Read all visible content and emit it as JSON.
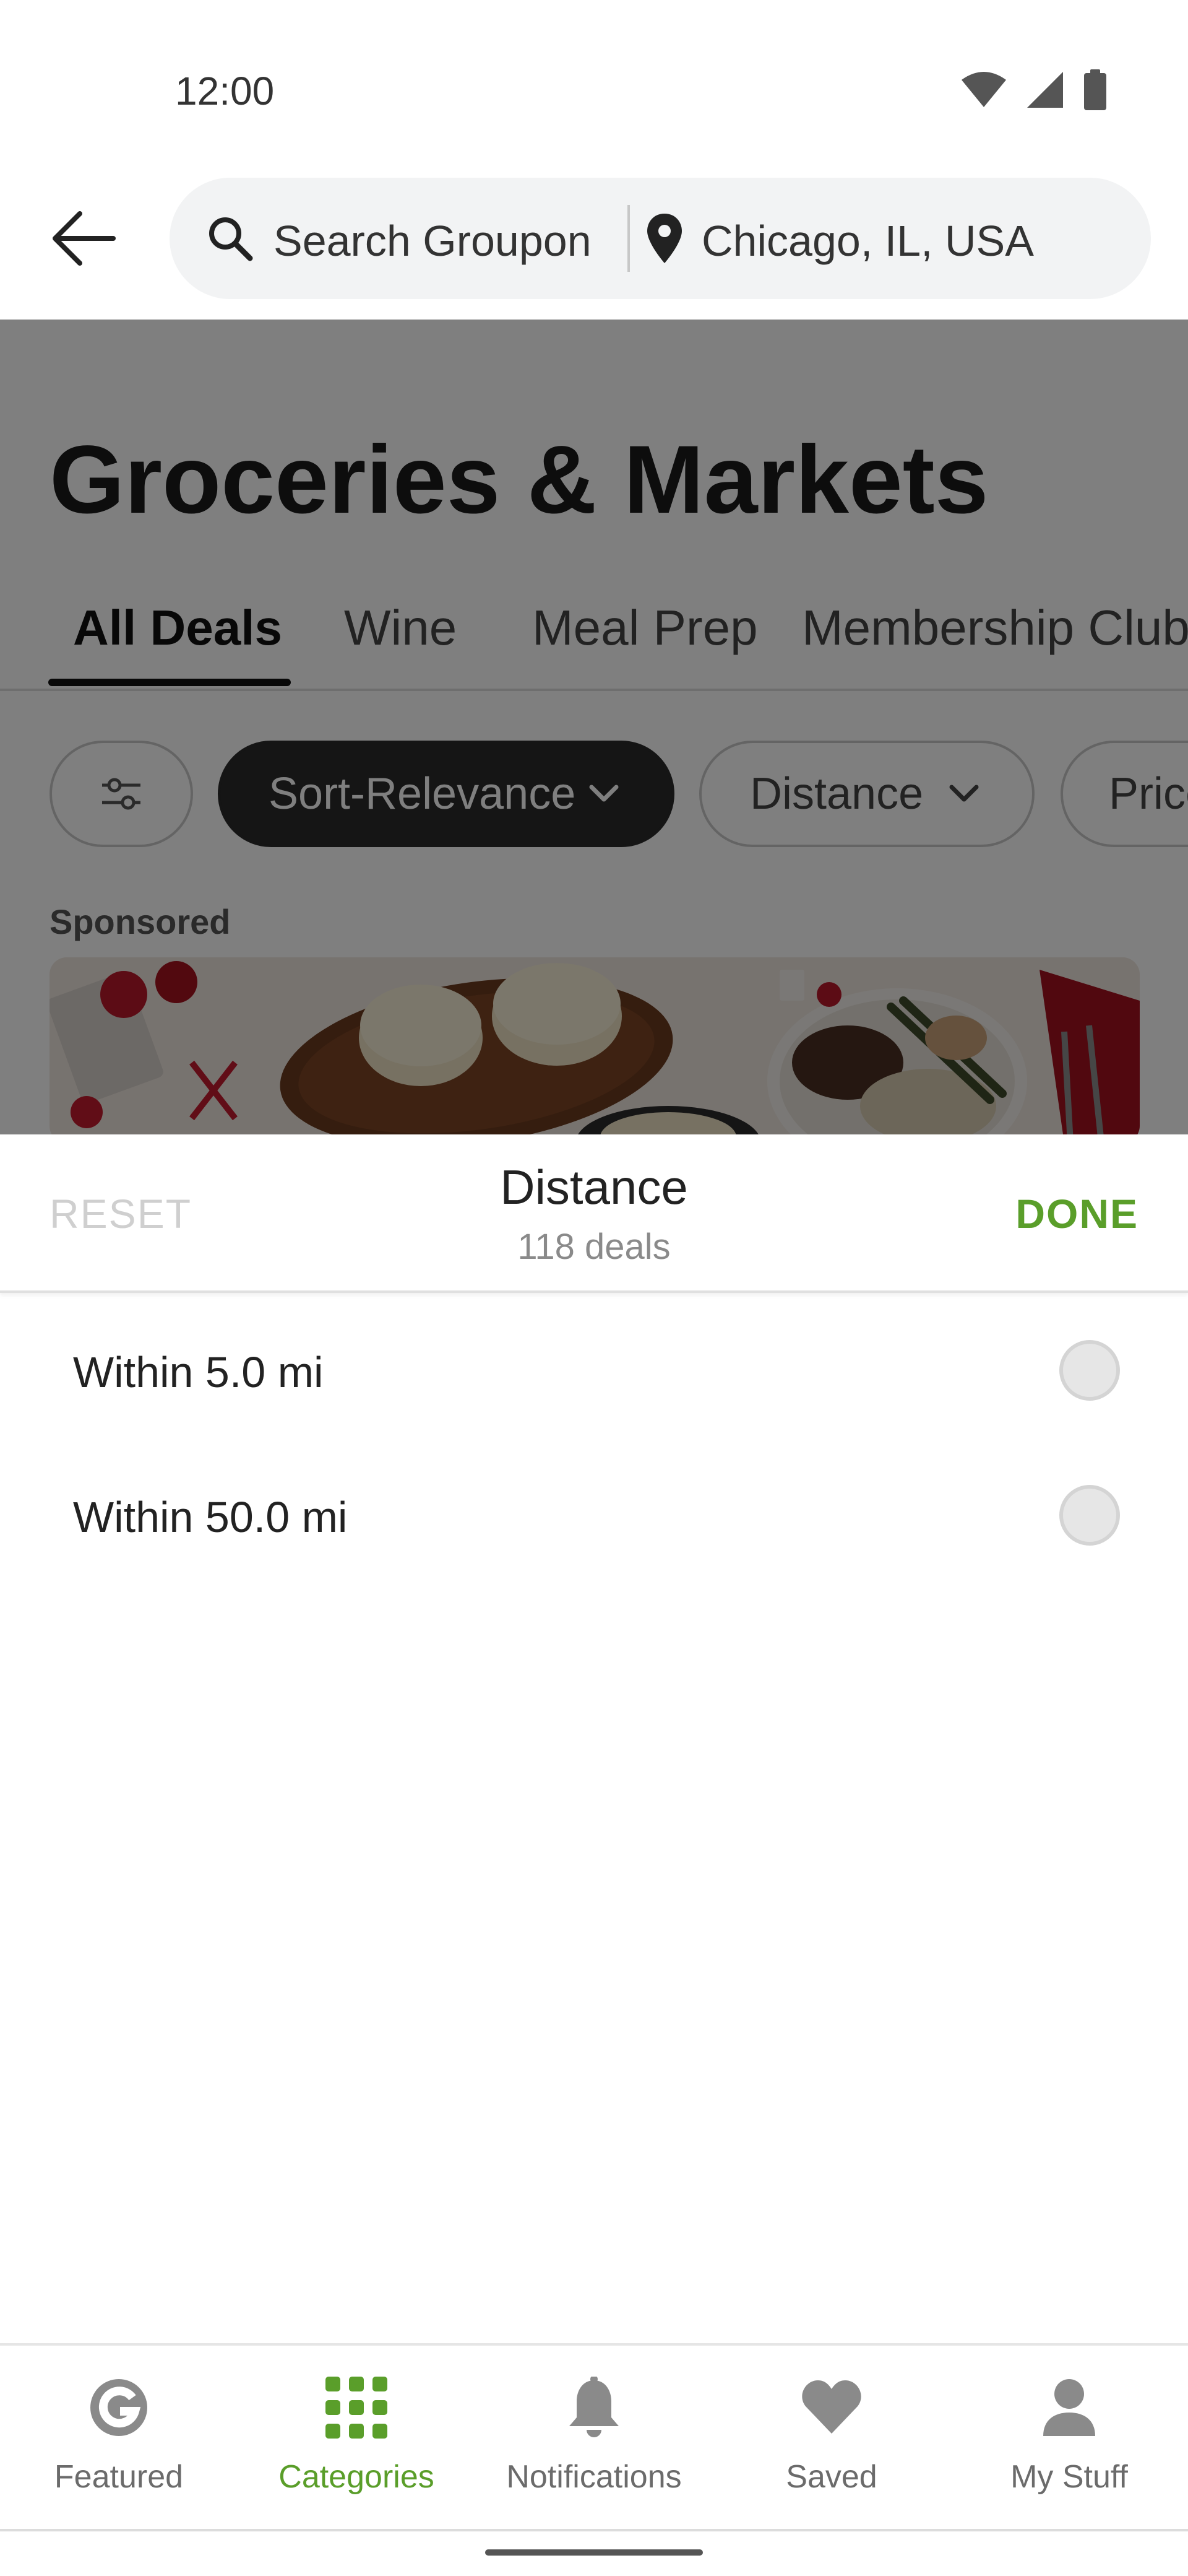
{
  "status_bar": {
    "time": "12:00"
  },
  "top_bar": {
    "search_text": "Search Groupon",
    "location_text": "Chicago, IL, USA"
  },
  "page": {
    "title": "Groceries & Markets",
    "tabs": [
      "All Deals",
      "Wine",
      "Meal Prep",
      "Membership Club"
    ],
    "active_tab": "All Deals",
    "filters": {
      "sort": "Sort-Relevance",
      "distance": "Distance",
      "price": "Price"
    },
    "sponsored_label": "Sponsored"
  },
  "sheet": {
    "reset_label": "RESET",
    "title": "Distance",
    "subtitle": "118 deals",
    "done_label": "DONE",
    "options": [
      {
        "label": "Within 5.0 mi",
        "selected": false
      },
      {
        "label": "Within 50.0 mi",
        "selected": false
      }
    ]
  },
  "bottom_nav": {
    "items": [
      {
        "label": "Featured",
        "icon": "groupon-g-icon"
      },
      {
        "label": "Categories",
        "icon": "grid-icon"
      },
      {
        "label": "Notifications",
        "icon": "bell-icon"
      },
      {
        "label": "Saved",
        "icon": "heart-icon"
      },
      {
        "label": "My Stuff",
        "icon": "person-icon"
      }
    ],
    "active": "Categories"
  },
  "colors": {
    "accent_green": "#5a9e2a",
    "scrim": "rgba(0,0,0,0.5)",
    "dark_chip": "#2a2a2a"
  }
}
